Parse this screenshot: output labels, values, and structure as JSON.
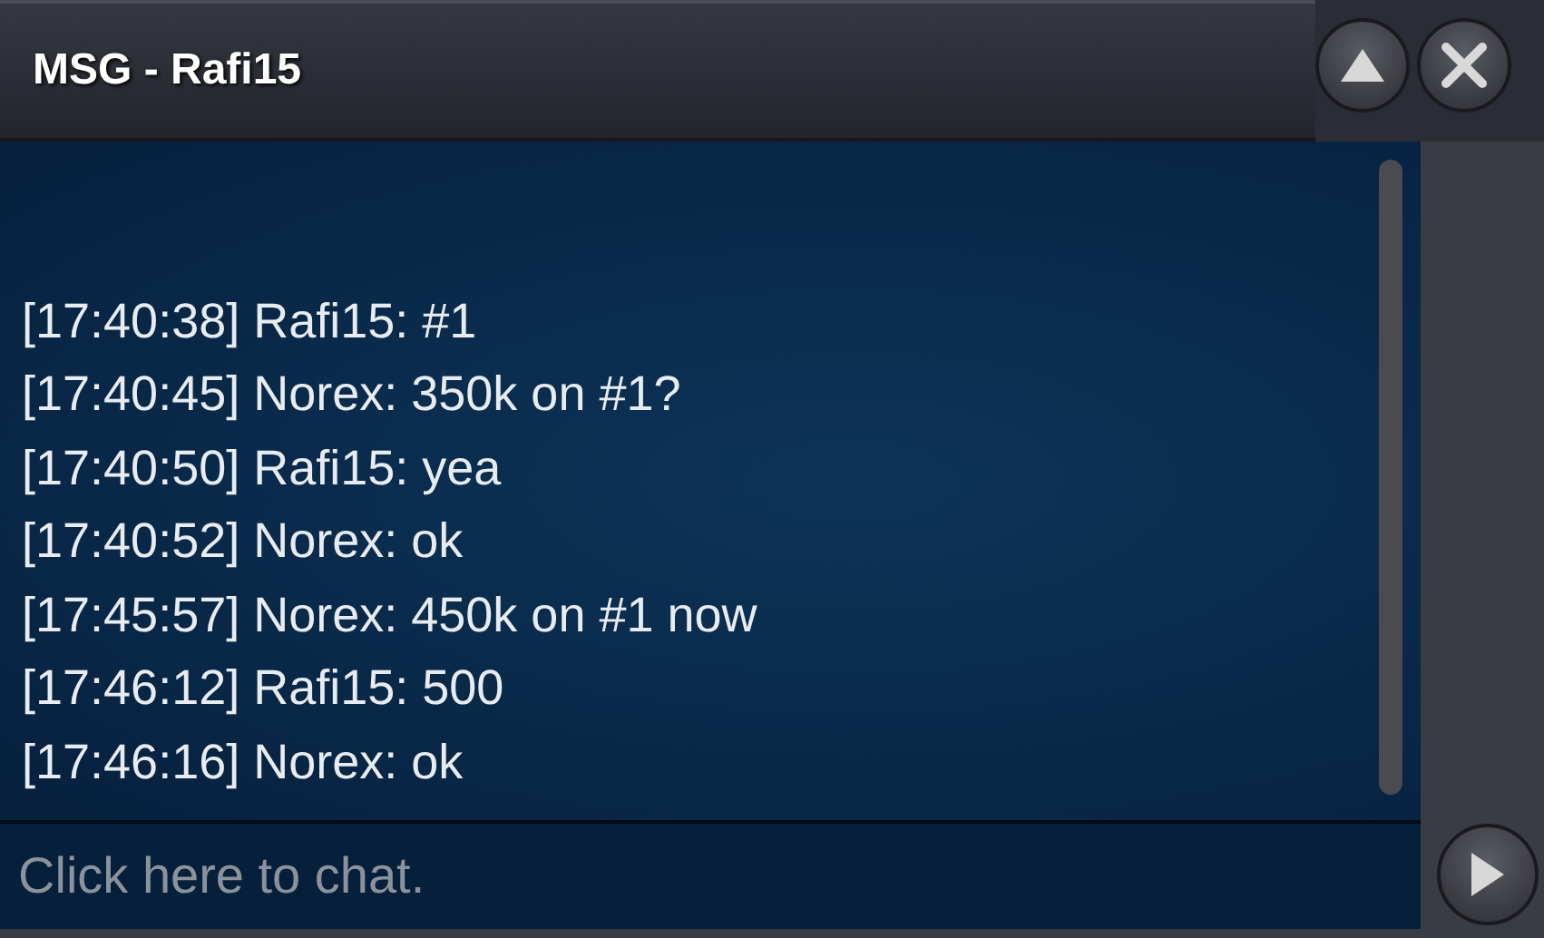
{
  "window": {
    "title": "MSG - Rafi15"
  },
  "messages": [
    "[17:40:38] Rafi15: #1",
    "[17:40:45] Norex: 350k on #1?",
    "[17:40:50] Rafi15: yea",
    "[17:40:52] Norex: ok",
    "[17:45:57] Norex: 450k on #1 now",
    "[17:46:12] Rafi15: 500",
    "[17:46:16] Norex: ok"
  ],
  "chat_input": {
    "placeholder": "Click here to chat."
  }
}
